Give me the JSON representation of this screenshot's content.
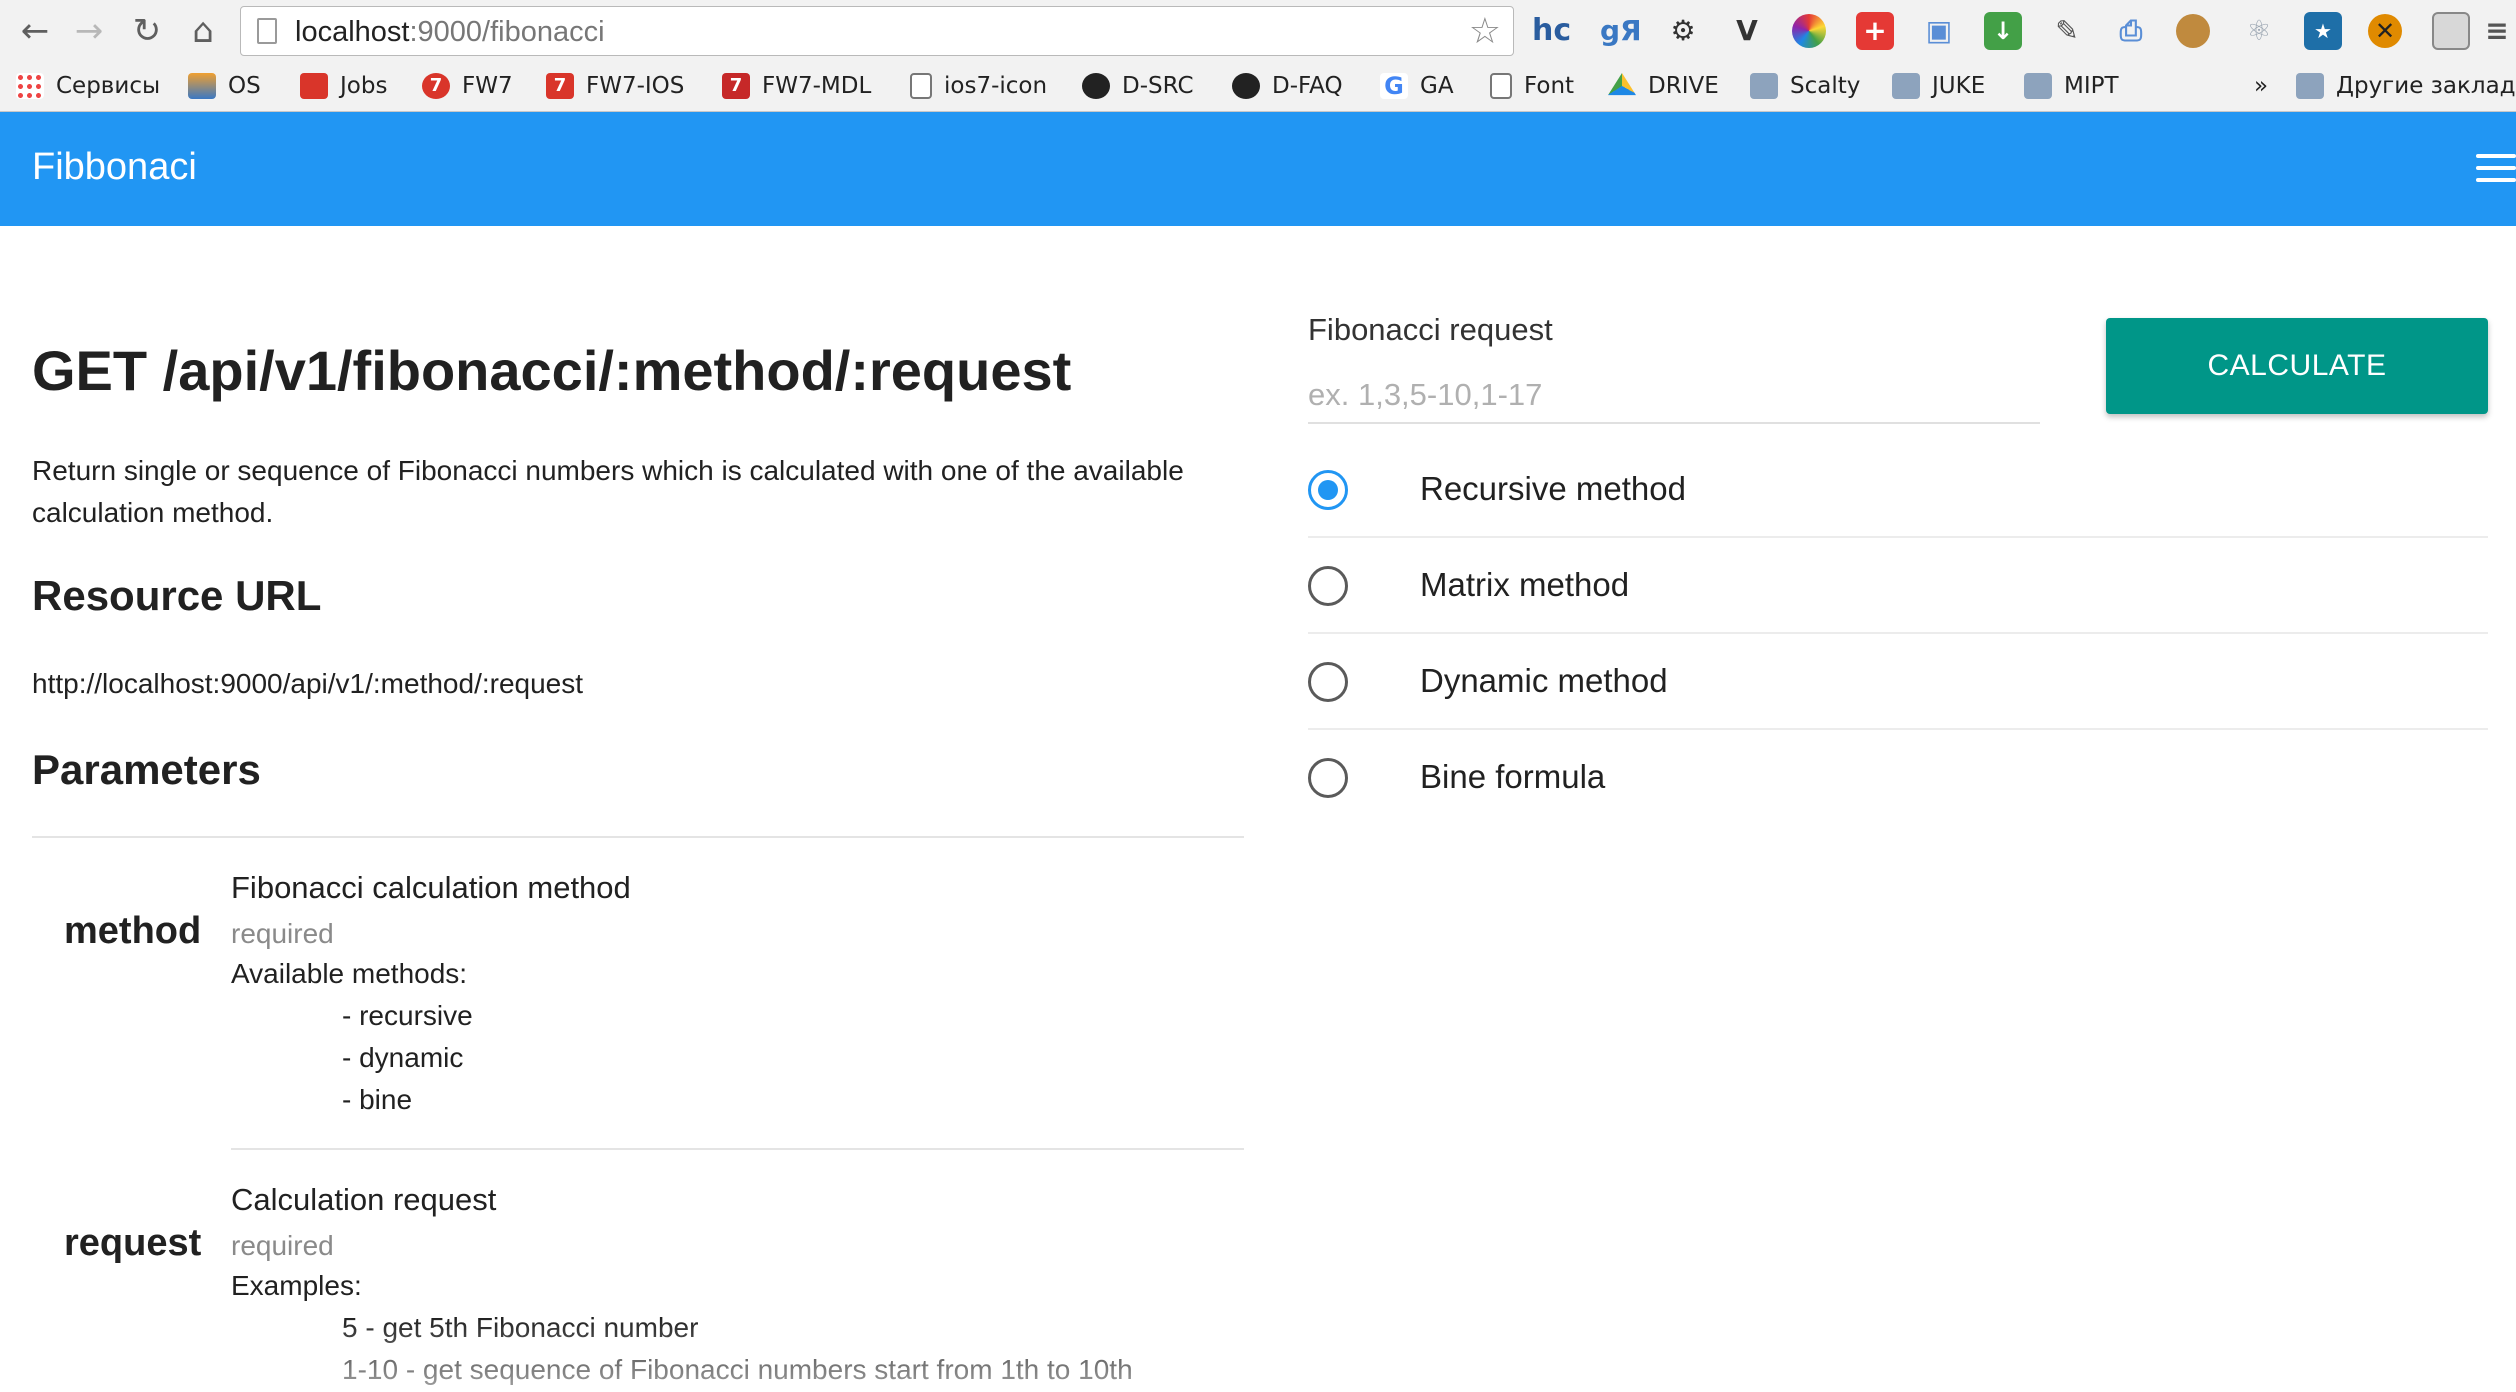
{
  "browser": {
    "url_host": "localhost",
    "url_path": ":9000/fibonacci",
    "extensions": [
      {
        "name": "hc",
        "icon": "hc-icon",
        "color": "#2a5d9f"
      },
      {
        "name": "yandex-translate",
        "icon": "gya-icon",
        "color": "#3a78c3"
      },
      {
        "name": "gear",
        "icon": "gear-icon",
        "color": "#333333"
      },
      {
        "name": "vivaldi",
        "icon": "v-icon",
        "color": "#333333"
      },
      {
        "name": "color-wheel",
        "icon": "color-wheel-icon",
        "color": "#e53935"
      },
      {
        "name": "plus",
        "icon": "red-plus-icon",
        "color": "#e53935"
      },
      {
        "name": "window",
        "icon": "window-icon",
        "color": "#5a8ed6"
      },
      {
        "name": "download",
        "icon": "download-icon",
        "color": "#43a047"
      },
      {
        "name": "eyedropper",
        "icon": "eyedropper-icon",
        "color": "#555555"
      },
      {
        "name": "printer",
        "icon": "printer-icon",
        "color": "#5a8ed6"
      },
      {
        "name": "cookie",
        "icon": "cookie-icon",
        "color": "#c08a3e"
      },
      {
        "name": "react",
        "icon": "react-icon",
        "color": "#9aa5b1"
      },
      {
        "name": "gallery",
        "icon": "gallery-icon",
        "color": "#1e6fa8"
      },
      {
        "name": "close-circle",
        "icon": "x-circle-icon",
        "color": "#e08a00"
      },
      {
        "name": "square",
        "icon": "square-icon",
        "color": "#888888"
      },
      {
        "name": "menu",
        "icon": "chrome-menu-icon",
        "color": "#555555"
      }
    ],
    "bookmarks": [
      {
        "label": "Сервисы",
        "icon": "apps-icon"
      },
      {
        "label": "OS",
        "icon": "stack-icon"
      },
      {
        "label": "Jobs",
        "icon": "jobs-icon"
      },
      {
        "label": "FW7",
        "icon": "fw7-icon"
      },
      {
        "label": "FW7-IOS",
        "icon": "fw7-ios-icon"
      },
      {
        "label": "FW7-MDL",
        "icon": "fw7-mdl-icon"
      },
      {
        "label": "ios7-icon",
        "icon": "file-icon"
      },
      {
        "label": "D-SRC",
        "icon": "github-icon"
      },
      {
        "label": "D-FAQ",
        "icon": "github-icon"
      },
      {
        "label": "GA",
        "icon": "google-icon"
      },
      {
        "label": "Font",
        "icon": "file-icon"
      },
      {
        "label": "DRIVE",
        "icon": "drive-icon"
      },
      {
        "label": "Scalty",
        "icon": "folder-icon"
      },
      {
        "label": "JUKE",
        "icon": "folder-icon"
      },
      {
        "label": "MIPT",
        "icon": "folder-icon"
      }
    ],
    "overflow_label": "»",
    "other_bookmarks": "Другие закладк"
  },
  "app": {
    "title": "Fibbonaci",
    "bar_color": "#2196f3"
  },
  "doc": {
    "endpoint": "GET /api/v1/fibonacci/:method/:request",
    "description": "Return single or sequence of Fibonacci numbers which is calculated with one of the available calculation method.",
    "resource_heading": "Resource URL",
    "resource_url": "http://localhost:9000/api/v1/:method/:request",
    "parameters_heading": "Parameters",
    "params": [
      {
        "name": "method",
        "title": "Fibonacci calculation method",
        "required": "required",
        "subtitle": "Available methods:",
        "lines": [
          "- recursive",
          "- dynamic",
          "- bine"
        ]
      },
      {
        "name": "request",
        "title": "Calculation request",
        "required": "required",
        "subtitle": "Examples:",
        "lines": [
          "5 - get 5th Fibonacci number",
          "1-10 - get sequence of Fibonacci numbers start from 1th to 10th"
        ]
      }
    ]
  },
  "form": {
    "label": "Fibonacci request",
    "placeholder": "ex. 1,3,5-10,1-17",
    "value": "",
    "button_label": "CALCULATE",
    "button_color": "#009688",
    "selected": "Recursive method",
    "methods": [
      "Recursive method",
      "Matrix method",
      "Dynamic method",
      "Bine formula"
    ]
  }
}
